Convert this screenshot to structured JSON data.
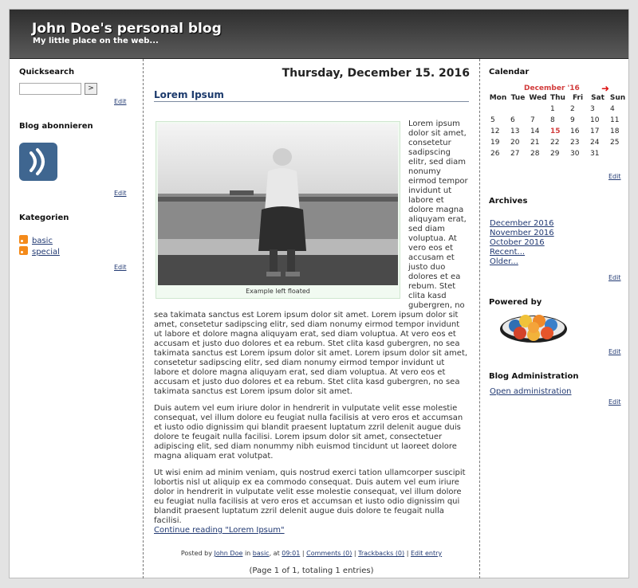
{
  "header": {
    "title": "John Doe's personal blog",
    "description": "My little place on the web..."
  },
  "left": {
    "quicksearch_title": "Quicksearch",
    "quicksearch_button": ">",
    "quicksearch_value": "",
    "edit": "Edit",
    "subscribe_title": "Blog abonnieren",
    "categories_title": "Kategorien",
    "categories": [
      "basic",
      "special"
    ]
  },
  "post": {
    "date": "Thursday, December 15. 2016",
    "title": "Lorem Ipsum",
    "figure_caption": "Example left floated",
    "paragraphs": [
      "Lorem ipsum dolor sit amet, consetetur sadipscing elitr, sed diam nonumy eirmod tempor invidunt ut labore et dolore magna aliquyam erat, sed diam voluptua. At vero eos et accusam et justo duo dolores et ea rebum. Stet clita kasd gubergren, no sea takimata sanctus est Lorem ipsum dolor sit amet. Lorem ipsum dolor sit amet, consetetur sadipscing elitr, sed diam nonumy eirmod tempor invidunt ut labore et dolore magna aliquyam erat, sed diam voluptua. At vero eos et accusam et justo duo dolores et ea rebum. Stet clita kasd gubergren, no sea takimata sanctus est Lorem ipsum dolor sit amet. Lorem ipsum dolor sit amet, consetetur sadipscing elitr, sed diam nonumy eirmod tempor invidunt ut labore et dolore magna aliquyam erat, sed diam voluptua. At vero eos et accusam et justo duo dolores et ea rebum. Stet clita kasd gubergren, no sea takimata sanctus est Lorem ipsum dolor sit amet.",
      "Duis autem vel eum iriure dolor in hendrerit in vulputate velit esse molestie consequat, vel illum dolore eu feugiat nulla facilisis at vero eros et accumsan et iusto odio dignissim qui blandit praesent luptatum zzril delenit augue duis dolore te feugait nulla facilisi. Lorem ipsum dolor sit amet, consectetuer adipiscing elit, sed diam nonummy nibh euismod tincidunt ut laoreet dolore magna aliquam erat volutpat.",
      "Ut wisi enim ad minim veniam, quis nostrud exerci tation ullamcorper suscipit lobortis nisl ut aliquip ex ea commodo consequat. Duis autem vel eum iriure dolor in hendrerit in vulputate velit esse molestie consequat, vel illum dolore eu feugiat nulla facilisis at vero eros et accumsan et iusto odio dignissim qui blandit praesent luptatum zzril delenit augue duis dolore te feugait nulla facilisi."
    ],
    "continue_label": "Continue reading \"Lorem Ipsum\"",
    "meta": {
      "posted_by": "Posted by",
      "author": "John Doe",
      "in": "in",
      "category": "basic",
      "at": ", at",
      "time": "09:01",
      "comments": "Comments (0)",
      "trackbacks": "Trackbacks (0)",
      "edit_entry": "Edit entry",
      "sep": "|"
    },
    "pager": "(Page 1 of 1, totaling 1 entries)"
  },
  "right": {
    "calendar_title": "Calendar",
    "calendar_month": "December '16",
    "calendar_next": "➜",
    "weekdays": [
      "Mon",
      "Tue",
      "Wed",
      "Thu",
      "Fri",
      "Sat",
      "Sun"
    ],
    "weeks": [
      [
        "",
        "",
        "",
        "1",
        "2",
        "3",
        "4"
      ],
      [
        "5",
        "6",
        "7",
        "8",
        "9",
        "10",
        "11"
      ],
      [
        "12",
        "13",
        "14",
        "15",
        "16",
        "17",
        "18"
      ],
      [
        "19",
        "20",
        "21",
        "22",
        "23",
        "24",
        "25"
      ],
      [
        "26",
        "27",
        "28",
        "29",
        "30",
        "31",
        ""
      ]
    ],
    "today": "15",
    "archives_title": "Archives",
    "archives": [
      "December 2016",
      "November 2016",
      "October 2016",
      "Recent...",
      "Older..."
    ],
    "powered_title": "Powered by",
    "admin_title": "Blog Administration",
    "admin_link": "Open administration",
    "edit": "Edit"
  }
}
